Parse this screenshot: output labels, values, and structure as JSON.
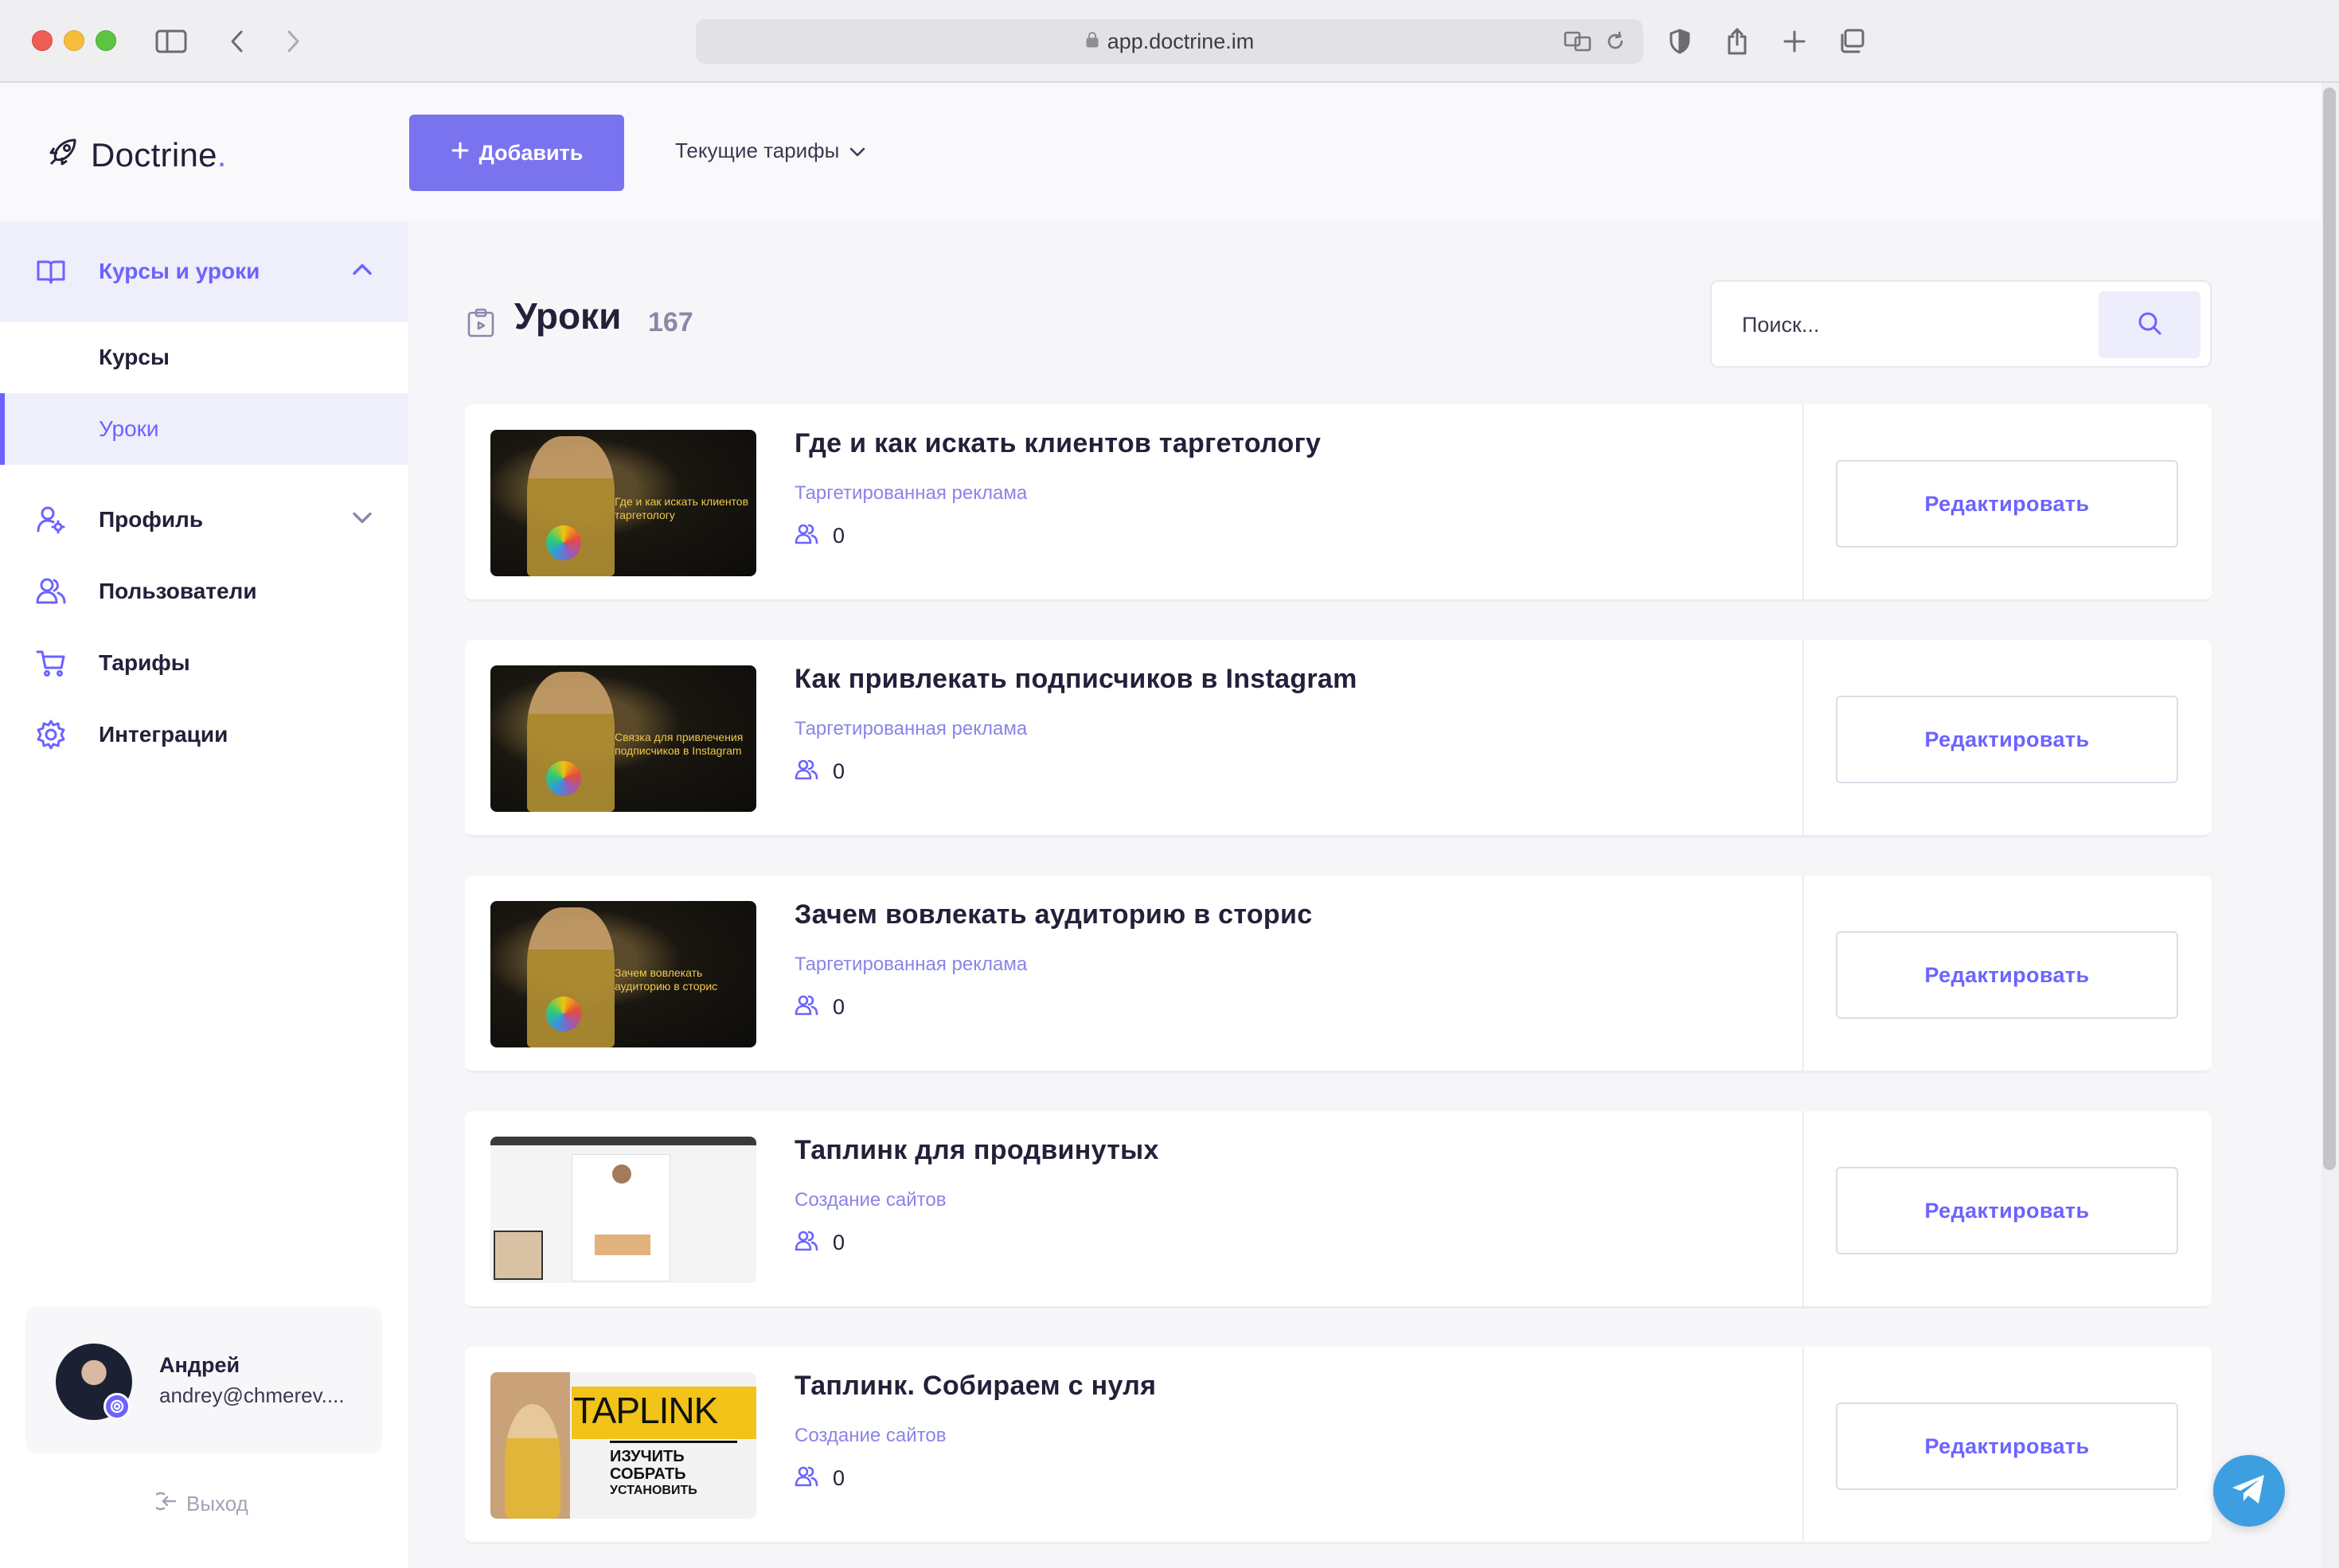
{
  "browser": {
    "url": "app.doctrine.im"
  },
  "brand": {
    "name": "Doctrine",
    "dot": "."
  },
  "topbar": {
    "add_label": "Добавить",
    "plans_label": "Текущие тарифы"
  },
  "sidebar": {
    "group": {
      "label": "Курсы и уроки",
      "icon": "book-icon"
    },
    "sub_items": [
      {
        "label": "Курсы",
        "active": false
      },
      {
        "label": "Уроки",
        "active": true
      }
    ],
    "items": [
      {
        "label": "Профиль",
        "icon": "user-icon",
        "expandable": true
      },
      {
        "label": "Пользователи",
        "icon": "users-icon"
      },
      {
        "label": "Тарифы",
        "icon": "cart-icon"
      },
      {
        "label": "Интеграции",
        "icon": "gear-icon"
      }
    ]
  },
  "user": {
    "name": "Андрей",
    "email": "andrey@chmerev...."
  },
  "logout_label": "Выход",
  "page": {
    "title": "Уроки",
    "count": "167"
  },
  "search": {
    "placeholder": "Поиск..."
  },
  "lessons": [
    {
      "title": "Где и как искать клиентов таргетологу",
      "category": "Таргетированная реклама",
      "students": "0",
      "thumb_caption": "Где и как искать клиентов таргетологу",
      "edit_label": "Редактировать"
    },
    {
      "title": "Как привлекать подписчиков в Instagram",
      "category": "Таргетированная реклама",
      "students": "0",
      "thumb_caption": "Связка для привлечения подписчиков в Instagram",
      "edit_label": "Редактировать"
    },
    {
      "title": "Зачем вовлекать аудиторию в сторис",
      "category": "Таргетированная реклама",
      "students": "0",
      "thumb_caption": "Зачем вовлекать аудиторию в сторис",
      "edit_label": "Редактировать"
    },
    {
      "title": "Таплинк для продвинутых",
      "category": "Создание сайтов",
      "students": "0",
      "edit_label": "Редактировать"
    },
    {
      "title": "Таплинк. Собираем с нуля",
      "category": "Создание сайтов",
      "students": "0",
      "thumb_brand": "TAPLINK",
      "thumb_lines": [
        "ИЗУЧИТЬ",
        "СОБРАТЬ",
        "УСТАНОВИТЬ"
      ],
      "edit_label": "Редактировать"
    }
  ],
  "colors": {
    "accent": "#6c63ff",
    "button": "#7a73f0",
    "telegram": "#3e9fe0"
  }
}
